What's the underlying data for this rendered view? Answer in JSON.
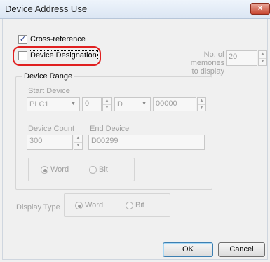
{
  "window": {
    "title": "Device Address Use",
    "close_glyph": "×"
  },
  "cross_reference": {
    "label": "Cross-reference",
    "checked": true,
    "check_glyph": "✓"
  },
  "device_designation": {
    "label": "Device Designation",
    "checked": false
  },
  "memories": {
    "label_line1": "No. of memories",
    "label_line2": "to display",
    "value": "20"
  },
  "device_range": {
    "label": "Device Range",
    "start_device_label": "Start Device",
    "plc_value": "PLC1",
    "station_value": "0",
    "device_type_value": "D",
    "address_value": "00000",
    "device_count_label": "Device Count",
    "device_count_value": "300",
    "end_device_label": "End Device",
    "end_device_value": "D00299",
    "word_label": "Word",
    "bit_label": "Bit",
    "selected": "Word"
  },
  "display_type": {
    "label": "Display Type",
    "word_label": "Word",
    "bit_label": "Bit",
    "selected": "Word"
  },
  "buttons": {
    "ok": "OK",
    "cancel": "Cancel"
  },
  "icons": {
    "spin_up": "▲",
    "spin_down": "▼",
    "dropdown": "▼"
  },
  "colors": {
    "highlight_ring": "#e02020",
    "disabled_text": "#a0a0a0"
  }
}
